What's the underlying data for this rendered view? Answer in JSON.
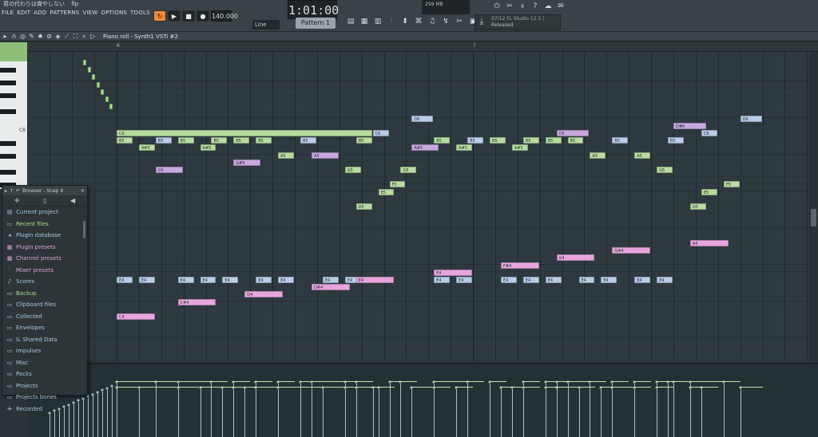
{
  "window": {
    "title_parts": [
      "君の代わりは賞やしない",
      "flp"
    ]
  },
  "menubar": [
    "FILE",
    "EDIT",
    "ADD",
    "PATTERNS",
    "VIEW",
    "OPTIONS",
    "TOOLS",
    "?"
  ],
  "transport": {
    "tempo": "140.000",
    "time": "1:01:00",
    "pattern": "Pattern 1",
    "snap": "Line"
  },
  "system": {
    "memory": "259 MB",
    "hint_line1": "07/12  FL Studio 12.5 |",
    "hint_line2": "Released"
  },
  "piano_roll": {
    "title": "Piano roll - Synth1 VSTi #2",
    "bar_numbers": [
      "6",
      "7"
    ],
    "octave_label": "C6"
  },
  "browser": {
    "title": "Browser - Snap 4",
    "items": [
      {
        "label": "Current project",
        "icon": "project-icon",
        "style": "bl"
      },
      {
        "label": "Recent files",
        "icon": "folder-icon",
        "style": "hl"
      },
      {
        "label": "Plugin database",
        "icon": "plugin-icon",
        "style": "bl"
      },
      {
        "label": "Plugin presets",
        "icon": "preset-icon",
        "style": "pk"
      },
      {
        "label": "Channel presets",
        "icon": "preset-icon",
        "style": "pk"
      },
      {
        "label": "Mixer presets",
        "icon": "mixer-icon",
        "style": "pk"
      },
      {
        "label": "Scores",
        "icon": "note-icon",
        "style": "bl"
      },
      {
        "label": "Backup",
        "icon": "folder-icon",
        "style": "hl"
      },
      {
        "label": "Clipboard files",
        "icon": "folder-icon",
        "style": "bl"
      },
      {
        "label": "Collected",
        "icon": "folder-icon",
        "style": "bl"
      },
      {
        "label": "Envelopes",
        "icon": "folder-icon",
        "style": "bl"
      },
      {
        "label": "IL Shared Data",
        "icon": "folder-icon",
        "style": "bl"
      },
      {
        "label": "Impulses",
        "icon": "folder-icon",
        "style": "bl"
      },
      {
        "label": "Misc",
        "icon": "folder-icon",
        "style": "bl"
      },
      {
        "label": "Packs",
        "icon": "folder-icon",
        "style": "bl"
      },
      {
        "label": "Projects",
        "icon": "folder-icon",
        "style": "bl"
      },
      {
        "label": "Projects bones",
        "icon": "folder-icon",
        "style": "bl"
      },
      {
        "label": "Recorded",
        "icon": "plus-icon",
        "style": "bl"
      }
    ]
  },
  "notes": [
    {
      "label": "C6",
      "color": "green",
      "step": 0,
      "row": 10,
      "len": 46
    },
    {
      "label": "C6",
      "color": "blue",
      "step": 46,
      "row": 10,
      "len": 3
    },
    {
      "label": "C6",
      "color": "purple",
      "step": 79,
      "row": 10,
      "len": 6
    },
    {
      "label": "C6",
      "color": "blue",
      "step": 105,
      "row": 10,
      "len": 3
    },
    {
      "label": "D6",
      "color": "blue",
      "step": 53,
      "row": 8,
      "len": 4
    },
    {
      "label": "D#6",
      "color": "purple",
      "step": 100,
      "row": 9,
      "len": 6
    },
    {
      "label": "D6",
      "color": "blue",
      "step": 112,
      "row": 8,
      "len": 4
    },
    {
      "label": "B5",
      "color": "green",
      "step": 0,
      "row": 11,
      "len": 3
    },
    {
      "label": "B5",
      "color": "blue",
      "step": 7,
      "row": 11,
      "len": 3
    },
    {
      "label": "B5",
      "color": "green",
      "step": 11,
      "row": 11,
      "len": 3
    },
    {
      "label": "B5",
      "color": "green",
      "step": 17,
      "row": 11,
      "len": 3
    },
    {
      "label": "B5",
      "color": "green",
      "step": 21,
      "row": 11,
      "len": 3
    },
    {
      "label": "B5",
      "color": "green",
      "step": 25,
      "row": 11,
      "len": 3
    },
    {
      "label": "B5",
      "color": "blue",
      "step": 33,
      "row": 11,
      "len": 3
    },
    {
      "label": "B5",
      "color": "green",
      "step": 43,
      "row": 11,
      "len": 3
    },
    {
      "label": "B5",
      "color": "green",
      "step": 57,
      "row": 11,
      "len": 3
    },
    {
      "label": "B5",
      "color": "blue",
      "step": 63,
      "row": 11,
      "len": 3
    },
    {
      "label": "B5",
      "color": "green",
      "step": 67,
      "row": 11,
      "len": 3
    },
    {
      "label": "B5",
      "color": "green",
      "step": 73,
      "row": 11,
      "len": 3
    },
    {
      "label": "B5",
      "color": "green",
      "step": 77,
      "row": 11,
      "len": 3
    },
    {
      "label": "B5",
      "color": "green",
      "step": 81,
      "row": 11,
      "len": 3
    },
    {
      "label": "B5",
      "color": "blue",
      "step": 89,
      "row": 11,
      "len": 3
    },
    {
      "label": "B5",
      "color": "blue",
      "step": 99,
      "row": 11,
      "len": 3
    },
    {
      "label": "A#5",
      "color": "green",
      "step": 4,
      "row": 12,
      "len": 3
    },
    {
      "label": "A#5",
      "color": "green",
      "step": 15,
      "row": 12,
      "len": 3
    },
    {
      "label": "A#5",
      "color": "purple",
      "step": 53,
      "row": 12,
      "len": 5
    },
    {
      "label": "A#5",
      "color": "green",
      "step": 61,
      "row": 12,
      "len": 3
    },
    {
      "label": "A#5",
      "color": "green",
      "step": 71,
      "row": 12,
      "len": 3
    },
    {
      "label": "A5",
      "color": "green",
      "step": 29,
      "row": 13,
      "len": 3
    },
    {
      "label": "A5",
      "color": "purple",
      "step": 35,
      "row": 13,
      "len": 5
    },
    {
      "label": "A5",
      "color": "green",
      "step": 85,
      "row": 13,
      "len": 3
    },
    {
      "label": "A5",
      "color": "green",
      "step": 93,
      "row": 13,
      "len": 3
    },
    {
      "label": "G#5",
      "color": "purple",
      "step": 21,
      "row": 14,
      "len": 5
    },
    {
      "label": "G5",
      "color": "purple",
      "step": 7,
      "row": 15,
      "len": 5
    },
    {
      "label": "G5",
      "color": "green",
      "step": 41,
      "row": 15,
      "len": 3
    },
    {
      "label": "G5",
      "color": "green",
      "step": 51,
      "row": 15,
      "len": 3
    },
    {
      "label": "G5",
      "color": "green",
      "step": 97,
      "row": 15,
      "len": 3
    },
    {
      "label": "F5",
      "color": "green",
      "step": 49,
      "row": 17,
      "len": 3
    },
    {
      "label": "F5",
      "color": "green",
      "step": 109,
      "row": 17,
      "len": 3
    },
    {
      "label": "E5",
      "color": "green",
      "step": 47,
      "row": 18,
      "len": 3
    },
    {
      "label": "E5",
      "color": "green",
      "step": 105,
      "row": 18,
      "len": 3
    },
    {
      "label": "D5",
      "color": "green",
      "step": 43,
      "row": 20,
      "len": 3
    },
    {
      "label": "D5",
      "color": "green",
      "step": 103,
      "row": 20,
      "len": 3
    },
    {
      "label": "A4",
      "color": "pink",
      "step": 103,
      "row": 25,
      "len": 7
    },
    {
      "label": "G#4",
      "color": "pink",
      "step": 89,
      "row": 26,
      "len": 7
    },
    {
      "label": "G4",
      "color": "pink",
      "step": 79,
      "row": 27,
      "len": 7
    },
    {
      "label": "F#4",
      "color": "pink",
      "step": 69,
      "row": 28,
      "len": 7
    },
    {
      "label": "F4",
      "color": "pink",
      "step": 57,
      "row": 29,
      "len": 7
    },
    {
      "label": "E4",
      "color": "blue",
      "step": 0,
      "row": 30,
      "len": 3
    },
    {
      "label": "E4",
      "color": "blue",
      "step": 4,
      "row": 30,
      "len": 3
    },
    {
      "label": "E4",
      "color": "blue",
      "step": 11,
      "row": 30,
      "len": 3
    },
    {
      "label": "E4",
      "color": "blue",
      "step": 15,
      "row": 30,
      "len": 3
    },
    {
      "label": "E4",
      "color": "blue",
      "step": 19,
      "row": 30,
      "len": 3
    },
    {
      "label": "E4",
      "color": "blue",
      "step": 25,
      "row": 30,
      "len": 3
    },
    {
      "label": "E4",
      "color": "blue",
      "step": 29,
      "row": 30,
      "len": 3
    },
    {
      "label": "E4",
      "color": "blue",
      "step": 37,
      "row": 30,
      "len": 3
    },
    {
      "label": "E4",
      "color": "blue",
      "step": 41,
      "row": 30,
      "len": 3
    },
    {
      "label": "E4",
      "color": "pink",
      "step": 43,
      "row": 30,
      "len": 7
    },
    {
      "label": "E4",
      "color": "blue",
      "step": 57,
      "row": 30,
      "len": 3
    },
    {
      "label": "E4",
      "color": "blue",
      "step": 61,
      "row": 30,
      "len": 3
    },
    {
      "label": "E4",
      "color": "blue",
      "step": 69,
      "row": 30,
      "len": 3
    },
    {
      "label": "E4",
      "color": "blue",
      "step": 73,
      "row": 30,
      "len": 3
    },
    {
      "label": "E4",
      "color": "blue",
      "step": 77,
      "row": 30,
      "len": 3
    },
    {
      "label": "E4",
      "color": "blue",
      "step": 83,
      "row": 30,
      "len": 3
    },
    {
      "label": "E4",
      "color": "blue",
      "step": 87,
      "row": 30,
      "len": 3
    },
    {
      "label": "E4",
      "color": "blue",
      "step": 93,
      "row": 30,
      "len": 3
    },
    {
      "label": "E4",
      "color": "blue",
      "step": 97,
      "row": 30,
      "len": 3
    },
    {
      "label": "D#4",
      "color": "pink",
      "step": 35,
      "row": 31,
      "len": 7
    },
    {
      "label": "D4",
      "color": "pink",
      "step": 23,
      "row": 32,
      "len": 7
    },
    {
      "label": "C#4",
      "color": "pink",
      "step": 11,
      "row": 33,
      "len": 7
    },
    {
      "label": "C4",
      "color": "pink",
      "step": 0,
      "row": 35,
      "len": 7
    }
  ]
}
